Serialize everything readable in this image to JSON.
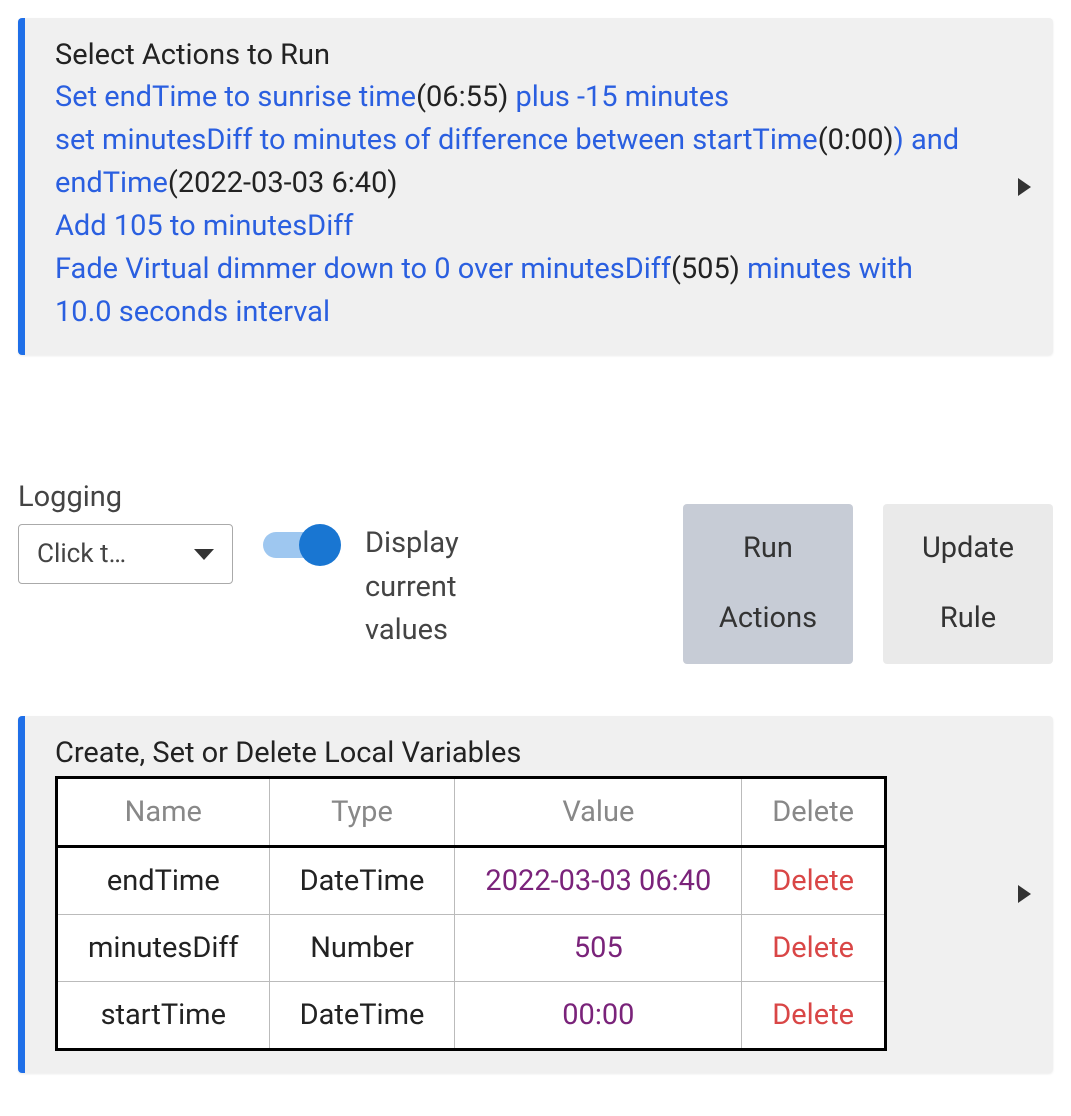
{
  "actions_panel": {
    "title": "Select Actions to Run",
    "line1_a": "Set endTime to sunrise time",
    "line1_b": "(06:55)",
    "line1_c": " plus -15 minutes",
    "line2_a": "set minutesDiff to minutes of difference between startTime",
    "line2_b": "(0:00)",
    "line2_c": ")",
    "line2_d": " and endTime",
    "line2_e": "(2022-03-03 6:40)",
    "line3": "Add 105 to minutesDiff",
    "line4_a": "Fade Virtual dimmer down to 0 over minutesDiff",
    "line4_b": "(505)",
    "line4_c": " minutes with 10.0 seconds interval"
  },
  "logging": {
    "label": "Logging",
    "dropdown_text": "Click t…"
  },
  "toggle": {
    "label": "Display current values",
    "on": true
  },
  "buttons": {
    "run": "Run\nActions",
    "update": "Update\nRule"
  },
  "vars_panel": {
    "title": "Create, Set or Delete Local Variables",
    "headers": {
      "name": "Name",
      "type": "Type",
      "value": "Value",
      "delete": "Delete"
    },
    "rows": [
      {
        "name": "endTime",
        "type": "DateTime",
        "value": "2022-03-03 06:40",
        "delete": "Delete"
      },
      {
        "name": "minutesDiff",
        "type": "Number",
        "value": "505",
        "delete": "Delete"
      },
      {
        "name": "startTime",
        "type": "DateTime",
        "value": "00:00",
        "delete": "Delete"
      }
    ]
  }
}
